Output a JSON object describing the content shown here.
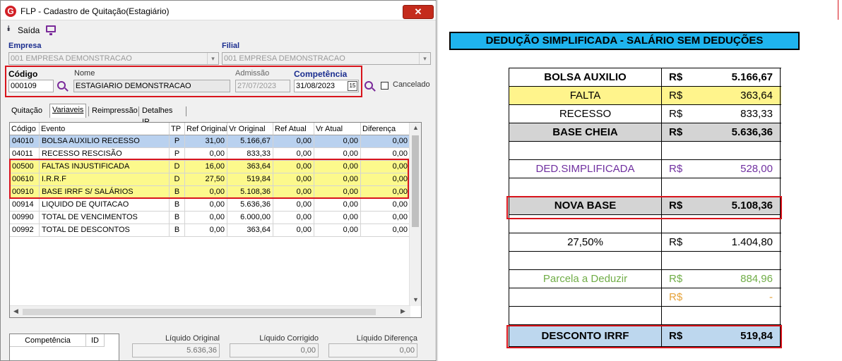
{
  "window": {
    "title": "FLP - Cadastro de Quitação(Estagiário)",
    "close_label": "✕",
    "app_icon_letter": "G"
  },
  "toolbar": {
    "exit_label": "Saída"
  },
  "form": {
    "empresa_label": "Empresa",
    "empresa_value": "001 EMPRESA DEMONSTRACAO",
    "filial_label": "Filial",
    "filial_value": "001 EMPRESA DEMONSTRACAO",
    "codigo_label": "Código",
    "codigo_value": "000109",
    "nome_label": "Nome",
    "nome_value": "ESTAGIARIO DEMONSTRACAO",
    "admissao_label": "Admissão",
    "admissao_value": "27/07/2023",
    "competencia_label": "Competência",
    "competencia_value": "31/08/2023",
    "calendar_day": "15",
    "cancelado_label": "Cancelado"
  },
  "tabs": [
    {
      "label": "Quitação"
    },
    {
      "label": "Variaveis"
    },
    {
      "label": "Reimpressão"
    },
    {
      "label": "Detalhes IR"
    }
  ],
  "grid": {
    "columns": [
      "Código",
      "Evento",
      "TP",
      "Ref Original",
      "Vr Original",
      "Ref Atual",
      "Vr Atual",
      "Diferença"
    ],
    "rows": [
      {
        "codigo": "04010",
        "evento": "BOLSA AUXILIO RECESSO",
        "tp": "P",
        "ref_original": "31,00",
        "vr_original": "5.166,67",
        "ref_atual": "0,00",
        "vr_atual": "0,00",
        "diferenca": "0,00",
        "highlight": "selected"
      },
      {
        "codigo": "04011",
        "evento": "RECESSO RESCISÃO",
        "tp": "P",
        "ref_original": "0,00",
        "vr_original": "833,33",
        "ref_atual": "0,00",
        "vr_atual": "0,00",
        "diferenca": "0,00",
        "highlight": "none"
      },
      {
        "codigo": "00500",
        "evento": "FALTAS INJUSTIFICADA",
        "tp": "D",
        "ref_original": "16,00",
        "vr_original": "363,64",
        "ref_atual": "0,00",
        "vr_atual": "0,00",
        "diferenca": "0,00",
        "highlight": "yellow"
      },
      {
        "codigo": "00610",
        "evento": "I.R.R.F",
        "tp": "D",
        "ref_original": "27,50",
        "vr_original": "519,84",
        "ref_atual": "0,00",
        "vr_atual": "0,00",
        "diferenca": "0,00",
        "highlight": "yellow"
      },
      {
        "codigo": "00910",
        "evento": "BASE IRRF S/ SALÁRIOS",
        "tp": "B",
        "ref_original": "0,00",
        "vr_original": "5.108,36",
        "ref_atual": "0,00",
        "vr_atual": "0,00",
        "diferenca": "0,00",
        "highlight": "yellow"
      },
      {
        "codigo": "00914",
        "evento": "LIQUIDO DE QUITACAO",
        "tp": "B",
        "ref_original": "0,00",
        "vr_original": "5.636,36",
        "ref_atual": "0,00",
        "vr_atual": "0,00",
        "diferenca": "0,00",
        "highlight": "none"
      },
      {
        "codigo": "00990",
        "evento": "TOTAL DE VENCIMENTOS",
        "tp": "B",
        "ref_original": "0,00",
        "vr_original": "6.000,00",
        "ref_atual": "0,00",
        "vr_atual": "0,00",
        "diferenca": "0,00",
        "highlight": "none"
      },
      {
        "codigo": "00992",
        "evento": "TOTAL DE DESCONTOS",
        "tp": "B",
        "ref_original": "0,00",
        "vr_original": "363,64",
        "ref_atual": "0,00",
        "vr_atual": "0,00",
        "diferenca": "0,00",
        "highlight": "none"
      }
    ]
  },
  "bottom": {
    "mini_columns": [
      "Competência",
      "ID"
    ],
    "liquido_original_label": "Líquido Original",
    "liquido_original_value": "5.636,36",
    "liquido_corrigido_label": "Líquido Corrigido",
    "liquido_corrigido_value": "0,00",
    "liquido_diferenca_label": "Líquido Diferença",
    "liquido_diferenca_value": "0,00"
  },
  "sheet": {
    "banner": "DEDUÇÃO SIMPLIFICADA - SALÁRIO SEM DEDUÇÕES",
    "rows": [
      {
        "label": "BOLSA AUXILIO",
        "currency": "R$",
        "value": "5.166,67",
        "bold": true,
        "bg": "#ffffff",
        "color": "#000000"
      },
      {
        "label": "FALTA",
        "currency": "R$",
        "value": "363,64",
        "bold": false,
        "bg": "#fff48c",
        "color": "#000000"
      },
      {
        "label": "RECESSO",
        "currency": "R$",
        "value": "833,33",
        "bold": false,
        "bg": "#ffffff",
        "color": "#000000"
      },
      {
        "label": "BASE CHEIA",
        "currency": "R$",
        "value": "5.636,36",
        "bold": true,
        "bg": "#d4d4d4",
        "color": "#000000"
      },
      {
        "label": "",
        "currency": "",
        "value": "",
        "bold": false,
        "bg": "#ffffff",
        "color": "#000000"
      },
      {
        "label": "DED.SIMPLIFICADA",
        "currency": "R$",
        "value": "528,00",
        "bold": false,
        "bg": "#ffffff",
        "color": "#7030a0"
      },
      {
        "label": "",
        "currency": "",
        "value": "",
        "bold": false,
        "bg": "#ffffff",
        "color": "#000000"
      },
      {
        "label": "NOVA BASE",
        "currency": "R$",
        "value": "5.108,36",
        "bold": true,
        "bg": "#d4d4d4",
        "color": "#000000"
      },
      {
        "label": "",
        "currency": "",
        "value": "",
        "bold": false,
        "bg": "#ffffff",
        "color": "#000000"
      },
      {
        "label": "27,50%",
        "currency": "R$",
        "value": "1.404,80",
        "bold": false,
        "bg": "#ffffff",
        "color": "#000000"
      },
      {
        "label": "",
        "currency": "",
        "value": "",
        "bold": false,
        "bg": "#ffffff",
        "color": "#000000"
      },
      {
        "label": "Parcela a Deduzir",
        "currency": "R$",
        "value": "884,96",
        "bold": false,
        "bg": "#ffffff",
        "color": "#70ad47"
      },
      {
        "label": "",
        "currency": "R$",
        "value": "-",
        "bold": false,
        "bg": "#ffffff",
        "color": "#e6a33a"
      },
      {
        "label": "",
        "currency": "",
        "value": "",
        "bold": false,
        "bg": "#ffffff",
        "color": "#000000"
      },
      {
        "label": "DESCONTO IRRF",
        "currency": "R$",
        "value": "519,84",
        "bold": true,
        "bg": "#bdd7ee",
        "color": "#000000"
      }
    ]
  },
  "colors": {
    "highlight_yellow": "#fcf98c",
    "selected_row": "#b9d1ef",
    "red_outline": "#d8141c",
    "banner_blue": "#1fb4ee"
  }
}
